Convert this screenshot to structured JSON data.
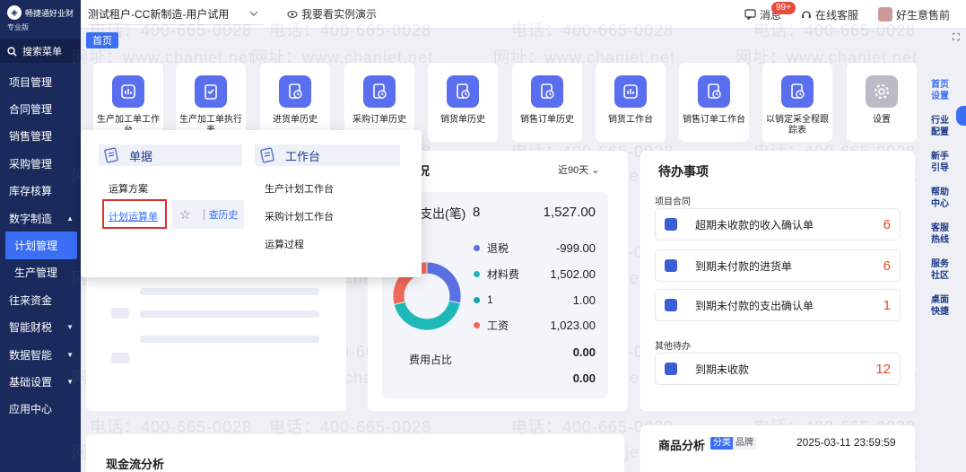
{
  "brand": {
    "name": "畅捷通好业财",
    "edition": "专业版"
  },
  "sidebar": {
    "search_label": "搜索菜单",
    "items": [
      {
        "label": "项目管理",
        "caret": ""
      },
      {
        "label": "合同管理",
        "caret": ""
      },
      {
        "label": "销售管理",
        "caret": ""
      },
      {
        "label": "采购管理",
        "caret": ""
      },
      {
        "label": "库存核算",
        "caret": ""
      },
      {
        "label": "数字制造",
        "caret": "▲"
      },
      {
        "label": "计划管理",
        "caret": ""
      },
      {
        "label": "生产管理",
        "caret": ""
      },
      {
        "label": "往来资金",
        "caret": ""
      },
      {
        "label": "智能财税",
        "caret": "▼"
      },
      {
        "label": "数据智能",
        "caret": "▼"
      },
      {
        "label": "基础设置",
        "caret": "▼"
      },
      {
        "label": "应用中心",
        "caret": ""
      }
    ]
  },
  "topbar": {
    "tenant": "测试租户-CC新制造-用户试用",
    "demo": "我要看实例演示",
    "message": "消息",
    "message_badge": "99+",
    "service": "在线客服",
    "user": "好生意售前"
  },
  "tabs": {
    "home": "首页"
  },
  "shortcuts": [
    {
      "label": "生产加工单工作台",
      "icon": "workbench-icon"
    },
    {
      "label": "生产加工单执行表",
      "icon": "checklist-icon"
    },
    {
      "label": "进货单历史",
      "icon": "history-doc-icon"
    },
    {
      "label": "采购订单历史",
      "icon": "history-doc-icon"
    },
    {
      "label": "销货单历史",
      "icon": "history-doc-icon"
    },
    {
      "label": "销售订单历史",
      "icon": "history-doc-icon"
    },
    {
      "label": "销货工作台",
      "icon": "workbench-icon"
    },
    {
      "label": "销售订单工作台",
      "icon": "history-doc-icon"
    },
    {
      "label": "以销定采全程跟踪表",
      "icon": "history-doc-icon"
    },
    {
      "label": "设置",
      "icon": "gear-icon"
    }
  ],
  "right_links": [
    {
      "label": "首页设置"
    },
    {
      "label": "行业配置"
    },
    {
      "label": "新手引导"
    },
    {
      "label": "帮助中心"
    },
    {
      "label": "客服热线"
    },
    {
      "label": "服务社区"
    },
    {
      "label": "桌面快捷"
    }
  ],
  "popup": {
    "group1_title": "单据",
    "group2_title": "工作台",
    "g1_item1": "运算方案",
    "g1_item2": "计划运算单",
    "g1_history": "查历史",
    "g2_items": [
      "生产计划工作台",
      "采购计划工作台",
      "运算过程"
    ]
  },
  "expense": {
    "title_fragment": "况",
    "range": "近90天",
    "sum_label": "支出(笔)",
    "sum_count": "8",
    "sum_amount": "1,527.00",
    "items": [
      {
        "name": "退税",
        "value": "-999.00",
        "color": "#5a6fe0"
      },
      {
        "name": "材料费",
        "value": "1,502.00",
        "color": "#1fb8b8"
      },
      {
        "name": "1",
        "value": "1.00",
        "color": "#16a6a6"
      },
      {
        "name": "工资",
        "value": "1,023.00",
        "color": "#ef6a5a"
      },
      {
        "name": "",
        "value": "0.00",
        "color": ""
      },
      {
        "name": "",
        "value": "0.00",
        "color": ""
      }
    ],
    "donut_label": "费用占比"
  },
  "chart_data": {
    "type": "pie",
    "title": "费用占比",
    "categories": [
      "退税",
      "材料费",
      "1",
      "工资"
    ],
    "values": [
      -999.0,
      1502.0,
      1.0,
      1023.0
    ]
  },
  "todo": {
    "title": "待办事项",
    "group1": "项目合同",
    "group2": "其他待办",
    "items": [
      {
        "label": "超期未收款的收入确认单",
        "count": "6"
      },
      {
        "label": "到期未付款的进货单",
        "count": "6"
      },
      {
        "label": "到期未付款的支出确认单",
        "count": "1"
      },
      {
        "label": "到期未收款",
        "count": "12"
      }
    ]
  },
  "goods": {
    "title": "商品分析",
    "tab_on": "分类",
    "tab_off": "品牌",
    "timestamp": "2025-03-11 23:59:59"
  },
  "cash": {
    "title": "现金流分析"
  },
  "watermark": {
    "phone": "电话：400-665-0028",
    "site": "网址：www.chanjet.net"
  },
  "colors": {
    "sidebar": "#1a2a5c",
    "accent": "#3a6ff5",
    "alert": "#e04a2c"
  }
}
